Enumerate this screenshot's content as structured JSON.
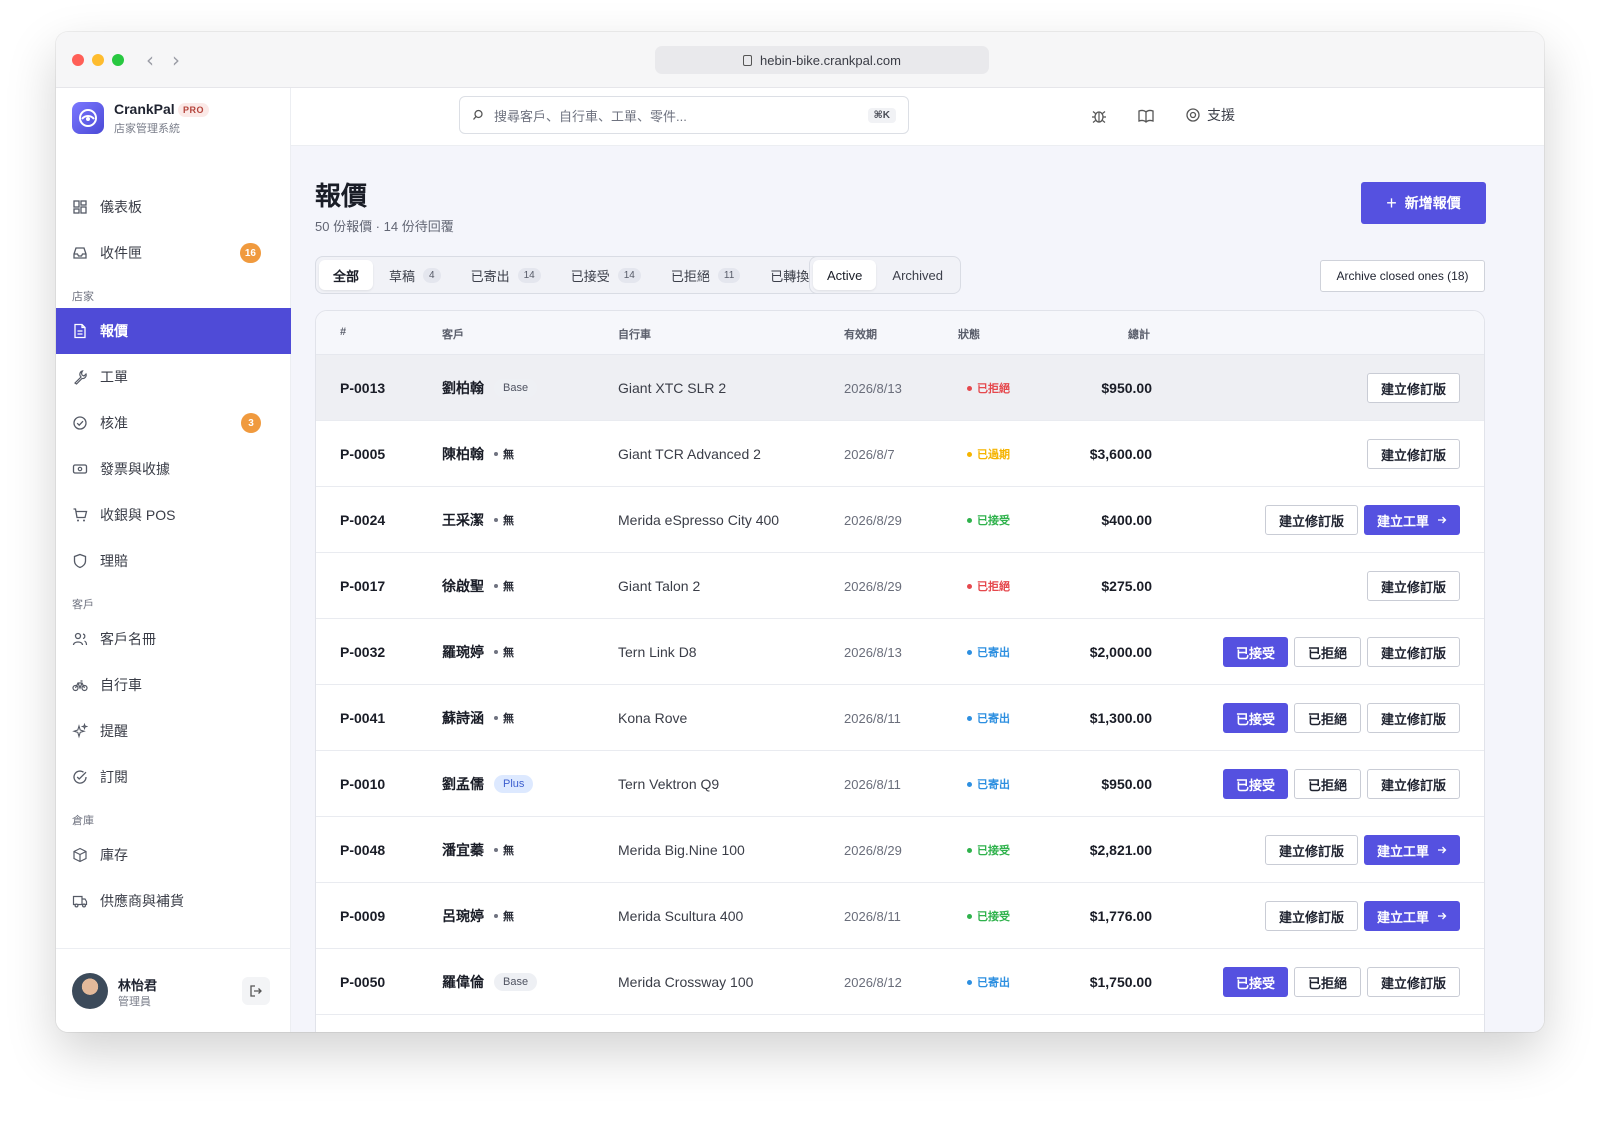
{
  "browser": {
    "url": "hebin-bike.crankpal.com"
  },
  "brand": {
    "name": "CrankPal",
    "badge": "PRO",
    "subtitle": "店家管理系統"
  },
  "search": {
    "placeholder": "搜尋客戶、自行車、工單、零件...",
    "shortcut": "⌘K"
  },
  "topbar": {
    "support_label": "支援"
  },
  "sidebar": {
    "items_top": [
      {
        "label": "儀表板",
        "icon": "dashboard-icon"
      },
      {
        "label": "收件匣",
        "icon": "inbox-icon",
        "badge": "16"
      }
    ],
    "sections": [
      {
        "title": "店家",
        "items": [
          {
            "label": "報價",
            "icon": "quote-icon",
            "active": true
          },
          {
            "label": "工單",
            "icon": "wrench-icon"
          },
          {
            "label": "核准",
            "icon": "check-circle-icon",
            "badge": "3"
          },
          {
            "label": "發票與收據",
            "icon": "receipt-icon"
          },
          {
            "label": "收銀與 POS",
            "icon": "cart-icon"
          },
          {
            "label": "理賠",
            "icon": "shield-icon"
          }
        ]
      },
      {
        "title": "客戶",
        "items": [
          {
            "label": "客戶名冊",
            "icon": "users-icon"
          },
          {
            "label": "自行車",
            "icon": "bike-icon"
          },
          {
            "label": "提醒",
            "icon": "sparkle-icon"
          },
          {
            "label": "訂閱",
            "icon": "subscription-icon"
          }
        ]
      },
      {
        "title": "倉庫",
        "items": [
          {
            "label": "庫存",
            "icon": "box-icon"
          },
          {
            "label": "供應商與補貨",
            "icon": "truck-icon"
          }
        ]
      }
    ]
  },
  "user": {
    "name": "林怡君",
    "role": "管理員"
  },
  "page": {
    "title": "報價",
    "subtitle": "50 份報價 · 14 份待回覆",
    "new_button": "新增報價",
    "archive_button": "Archive closed ones (18)"
  },
  "status_tabs": [
    {
      "label": "全部",
      "active": true
    },
    {
      "label": "草稿",
      "count": "4"
    },
    {
      "label": "已寄出",
      "count": "14"
    },
    {
      "label": "已接受",
      "count": "14"
    },
    {
      "label": "已拒絕",
      "count": "11"
    },
    {
      "label": "已轉換"
    }
  ],
  "scope_tabs": [
    {
      "label": "Active",
      "active": true
    },
    {
      "label": "Archived"
    }
  ],
  "table": {
    "columns": [
      "#",
      "客戶",
      "自行車",
      "有效期",
      "狀態",
      "總計"
    ],
    "rows": [
      {
        "id": "P-0013",
        "customer": "劉柏翰",
        "tier": "Base",
        "tier_type": "base",
        "bike": "Giant XTC SLR 2",
        "valid_until": "2026/8/13",
        "status": "已拒絕",
        "status_color": "#e5484d",
        "total": "$950.00",
        "actions": [
          "建立修訂版"
        ]
      },
      {
        "id": "P-0005",
        "customer": "陳柏翰",
        "tier": "無",
        "tier_type": "none",
        "bike": "Giant TCR Advanced 2",
        "valid_until": "2026/8/7",
        "status": "已過期",
        "status_color": "#f5b400",
        "total": "$3,600.00",
        "actions": [
          "建立修訂版"
        ]
      },
      {
        "id": "P-0024",
        "customer": "王采潔",
        "tier": "無",
        "tier_type": "none",
        "bike": "Merida eSpresso City 400",
        "valid_until": "2026/8/29",
        "status": "已接受",
        "status_color": "#2fb24c",
        "total": "$400.00",
        "actions": [
          "建立修訂版",
          "建立工單"
        ]
      },
      {
        "id": "P-0017",
        "customer": "徐啟聖",
        "tier": "無",
        "tier_type": "none",
        "bike": "Giant Talon 2",
        "valid_until": "2026/8/29",
        "status": "已拒絕",
        "status_color": "#e5484d",
        "total": "$275.00",
        "actions": [
          "建立修訂版"
        ]
      },
      {
        "id": "P-0032",
        "customer": "羅琬婷",
        "tier": "無",
        "tier_type": "none",
        "bike": "Tern Link D8",
        "valid_until": "2026/8/13",
        "status": "已寄出",
        "status_color": "#2d8fe0",
        "total": "$2,000.00",
        "actions": [
          "已接受",
          "已拒絕",
          "建立修訂版"
        ]
      },
      {
        "id": "P-0041",
        "customer": "蘇詩涵",
        "tier": "無",
        "tier_type": "none",
        "bike": "Kona Rove",
        "valid_until": "2026/8/11",
        "status": "已寄出",
        "status_color": "#2d8fe0",
        "total": "$1,300.00",
        "actions": [
          "已接受",
          "已拒絕",
          "建立修訂版"
        ]
      },
      {
        "id": "P-0010",
        "customer": "劉孟儒",
        "tier": "Plus",
        "tier_type": "plus",
        "bike": "Tern Vektron Q9",
        "valid_until": "2026/8/11",
        "status": "已寄出",
        "status_color": "#2d8fe0",
        "total": "$950.00",
        "actions": [
          "已接受",
          "已拒絕",
          "建立修訂版"
        ]
      },
      {
        "id": "P-0048",
        "customer": "潘宜蓁",
        "tier": "無",
        "tier_type": "none",
        "bike": "Merida Big.Nine 100",
        "valid_until": "2026/8/29",
        "status": "已接受",
        "status_color": "#2fb24c",
        "total": "$2,821.00",
        "actions": [
          "建立修訂版",
          "建立工單"
        ]
      },
      {
        "id": "P-0009",
        "customer": "呂琬婷",
        "tier": "無",
        "tier_type": "none",
        "bike": "Merida Scultura 400",
        "valid_until": "2026/8/11",
        "status": "已接受",
        "status_color": "#2fb24c",
        "total": "$1,776.00",
        "actions": [
          "建立修訂版",
          "建立工單"
        ]
      },
      {
        "id": "P-0050",
        "customer": "羅偉倫",
        "tier": "Base",
        "tier_type": "base",
        "bike": "Merida Crossway 100",
        "valid_until": "2026/8/12",
        "status": "已寄出",
        "status_color": "#2d8fe0",
        "total": "$1,750.00",
        "actions": [
          "已接受",
          "已拒絕",
          "建立修訂版"
        ]
      }
    ]
  },
  "colors": {
    "accent": "#5551e0",
    "sidebar_active": "#4f4bd7",
    "badge": "#f09a3e"
  }
}
